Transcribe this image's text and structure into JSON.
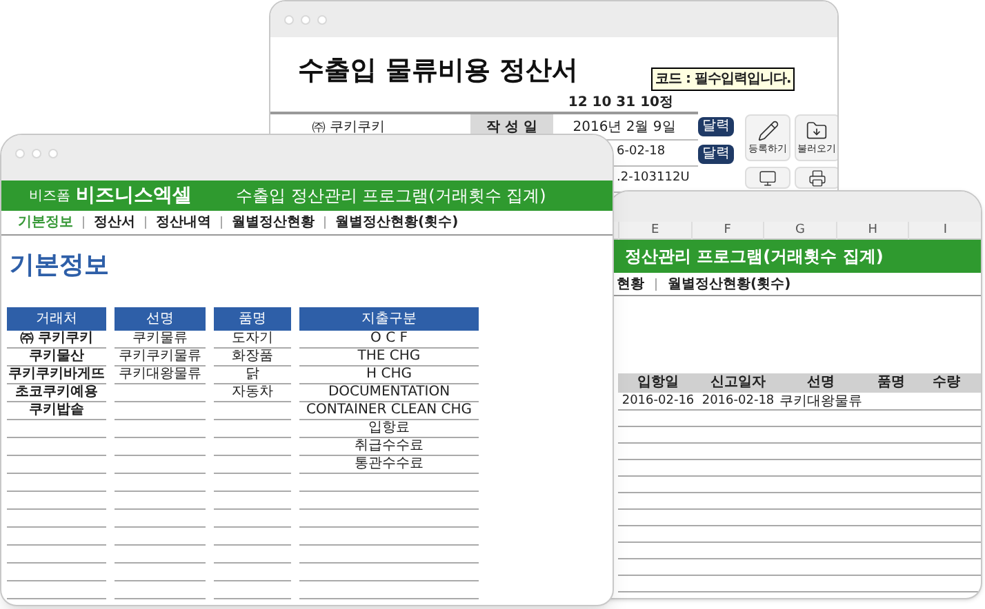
{
  "back_window": {
    "title": "수출입 물류비용 정산서",
    "code_line": "12 10 31 10정",
    "note": "코드 : 필수입력입니다.",
    "company": "㈜ 쿠키쿠키",
    "rows": [
      {
        "label": "작 성 일",
        "value": "2016년 2월 9일",
        "button": "달력"
      },
      {
        "value": "6-02-18",
        "button": "달력"
      },
      {
        "value": ".2-103112U"
      }
    ],
    "actions": [
      {
        "kind": "edit",
        "label": "등록하기"
      },
      {
        "kind": "load",
        "label": "불러오기"
      },
      {
        "kind": "screen"
      },
      {
        "kind": "print"
      }
    ]
  },
  "middle_window": {
    "column_letters": [
      "E",
      "F",
      "G",
      "H",
      "I"
    ],
    "banner": "정산관리 프로그램(거래횟수 집계)",
    "nav": [
      "현황",
      "월별정산현황(횟수)"
    ],
    "table": {
      "columns": [
        "입항일",
        "신고일자",
        "선명",
        "품명",
        "수량"
      ],
      "rows": [
        [
          "2016-02-16",
          "2016-02-18",
          "쿠키대왕물류",
          "",
          ""
        ]
      ]
    }
  },
  "front_window": {
    "brand_small": "비즈폼",
    "brand": "비즈니스엑셀",
    "banner": "수출입 정산관리 프로그램(거래횟수 집계)",
    "nav": [
      {
        "label": "기본정보",
        "selected": true
      },
      {
        "label": "정산서",
        "selected": false
      },
      {
        "label": "정산내역",
        "selected": false
      },
      {
        "label": "월별정산현황",
        "selected": false
      },
      {
        "label": "월별정산현황(횟수)",
        "selected": false
      }
    ],
    "heading": "기본정보",
    "lists": [
      {
        "title": "거래처",
        "bold": true,
        "items": [
          "㈜ 쿠키쿠키",
          "쿠키물산",
          "쿠키쿠키바게뜨",
          "초코쿠키예용",
          "쿠키밥솥"
        ]
      },
      {
        "title": "선명",
        "bold": false,
        "items": [
          "쿠키물류",
          "쿠키쿠키물류",
          "쿠키대왕물류"
        ]
      },
      {
        "title": "품명",
        "bold": false,
        "items": [
          "도자기",
          "화장품",
          "닭",
          "자동차"
        ]
      },
      {
        "title": "지출구분",
        "bold": false,
        "items": [
          "O C F",
          "THE CHG",
          "H CHG",
          "DOCUMENTATION",
          "CONTAINER CLEAN CHG",
          "입항료",
          "취급수수료",
          "통관수수료"
        ]
      }
    ]
  }
}
